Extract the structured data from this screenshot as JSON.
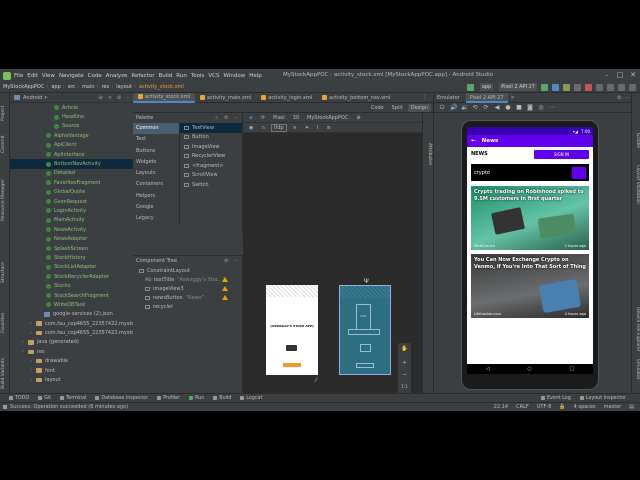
{
  "window": {
    "title": "MyStockAppPOC - activity_stock.xml [MyStockAppPOC.app] - Android Studio",
    "menu": [
      "File",
      "Edit",
      "View",
      "Navigate",
      "Code",
      "Analyze",
      "Refactor",
      "Build",
      "Run",
      "Tools",
      "VCS",
      "Window",
      "Help"
    ]
  },
  "breadcrumb": [
    "MyStockAppPOC",
    "app",
    "src",
    "main",
    "res",
    "layout",
    "activity_stock.xml"
  ],
  "toolbar": {
    "run_config": "app",
    "device": "Pixel 2 API 27"
  },
  "left_strip": [
    "Project",
    "Commit",
    "Resource Manager",
    "Structure",
    "Favorites",
    "Build Variants"
  ],
  "project": {
    "view": "Android",
    "items": [
      {
        "label": "Article",
        "icon": "class",
        "depth": 5
      },
      {
        "label": "Headline",
        "icon": "class",
        "depth": 5
      },
      {
        "label": "Source",
        "icon": "class",
        "depth": 5
      },
      {
        "label": "AlphaVantage",
        "icon": "class",
        "depth": 4
      },
      {
        "label": "ApiClient",
        "icon": "class",
        "depth": 4
      },
      {
        "label": "ApiInterface",
        "icon": "class",
        "depth": 4
      },
      {
        "label": "BottomNavActivity",
        "icon": "class",
        "depth": 4,
        "selected": true
      },
      {
        "label": "Detailed",
        "icon": "class",
        "depth": 4
      },
      {
        "label": "FavoritesFragment",
        "icon": "class",
        "depth": 4
      },
      {
        "label": "GlobalQuote",
        "icon": "class",
        "depth": 4
      },
      {
        "label": "GsonRequest",
        "icon": "class",
        "depth": 4
      },
      {
        "label": "LoginActivity",
        "icon": "class",
        "depth": 4
      },
      {
        "label": "MainActivity",
        "icon": "class",
        "depth": 4
      },
      {
        "label": "NewsActivity",
        "icon": "class",
        "depth": 4
      },
      {
        "label": "NewsAdapter",
        "icon": "class",
        "depth": 4
      },
      {
        "label": "SplashScreen",
        "icon": "class",
        "depth": 4
      },
      {
        "label": "StockHistory",
        "icon": "class",
        "depth": 4
      },
      {
        "label": "StockListAdapter",
        "icon": "class",
        "depth": 4
      },
      {
        "label": "StockRecyclerAdapter",
        "icon": "class",
        "depth": 4
      },
      {
        "label": "Stocks",
        "icon": "class",
        "depth": 4
      },
      {
        "label": "StockSearchFragment",
        "icon": "class",
        "depth": 4
      },
      {
        "label": "WriteDBTask",
        "icon": "class",
        "depth": 4
      },
      {
        "label": "google-services (2).json",
        "icon": "file",
        "depth": 3
      },
      {
        "label": "com.fau_cop4655_22357422.mysto",
        "icon": "folder",
        "depth": 2
      },
      {
        "label": "com.fau_cop4655_22357422.mysto",
        "icon": "folder",
        "depth": 2
      },
      {
        "label": "java (generated)",
        "icon": "folder",
        "depth": 1
      },
      {
        "label": "res",
        "icon": "folder",
        "depth": 1
      },
      {
        "label": "drawable",
        "icon": "folder",
        "depth": 2
      },
      {
        "label": "font",
        "icon": "folder",
        "depth": 2
      },
      {
        "label": "layout",
        "icon": "folder",
        "depth": 2
      }
    ]
  },
  "editor_tabs": [
    {
      "label": "activity_stock.xml",
      "active": true
    },
    {
      "label": "activity_main.xml",
      "active": false
    },
    {
      "label": "activity_login.xml",
      "active": false
    },
    {
      "label": "activity_bottom_nav.xml",
      "active": false
    }
  ],
  "view_modes": [
    "Code",
    "Split",
    "Design"
  ],
  "design_toolbar": {
    "device": "Pixel",
    "api": "30",
    "theme": "MyStockAppPOC",
    "margin": "0dp"
  },
  "palette": {
    "title": "Palette",
    "categories": [
      "Common",
      "Text",
      "Buttons",
      "Widgets",
      "Layouts",
      "Containers",
      "Helpers",
      "Google",
      "Legacy"
    ],
    "items": [
      "TextView",
      "Button",
      "ImageView",
      "RecyclerView",
      "<fragment>",
      "ScrollView",
      "Switch"
    ]
  },
  "component_tree": {
    "title": "Component Tree",
    "rows": [
      {
        "label": "ConstraintLayout",
        "depth": 0,
        "warn": false
      },
      {
        "label": "textTitle",
        "extra": "\"Aswaggy's Stoc...\"",
        "prefix": "Ab",
        "depth": 1,
        "warn": true
      },
      {
        "label": "imageView3",
        "depth": 1,
        "warn": true
      },
      {
        "label": "newsButton",
        "extra": "\"News\"",
        "depth": 1,
        "warn": true
      },
      {
        "label": "recycler",
        "depth": 1,
        "warn": false
      }
    ]
  },
  "design_preview": {
    "app_title": "[ASWAGGY'S STOCK APP]"
  },
  "blueprint": {
    "margin_label": "336"
  },
  "canvas_zoom": {
    "ratio": "1:1"
  },
  "emulator": {
    "tool_label": "Emulator",
    "device_tab": "Pixel 2 API 27"
  },
  "phone": {
    "time": "7:00",
    "app_bar_title": "News",
    "news_label": "NEWS",
    "sign_in": "SIGN IN",
    "search_value": "crypto",
    "cards": [
      {
        "title": "Crypto trading on Robinhood spiked to 9.5M customers in first quarter",
        "source": "TechCrunch",
        "time": "2 hours ago"
      },
      {
        "title": "You Can Now Exchange Crypto on Venmo, if You're Into That Sort of Thing",
        "source": "Lifehacker.com",
        "time": "4 hours ago"
      }
    ]
  },
  "right_strip": [
    "Gradle",
    "Layout Validation",
    "Device File Explorer",
    "Emulator"
  ],
  "bottom_tabs": [
    "TODO",
    "Git",
    "Terminal",
    "Database Inspector",
    "Profiler",
    "Run",
    "Build",
    "Logcat",
    "Event Log",
    "Layout Inspector"
  ],
  "status": {
    "message": "Success: Operation succeeded (6 minutes ago)",
    "position": "22:14",
    "line_sep": "CRLF",
    "encoding": "UTF-8",
    "indent": "4 spaces",
    "branch": "master"
  },
  "colors": {
    "ide_bg": "#3c3f41",
    "editor_bg": "#2b2b2b",
    "accent": "#4a88c7",
    "purple": "#6200ee",
    "purple_dark": "#3700b3",
    "class_green": "#8fbf7f"
  }
}
